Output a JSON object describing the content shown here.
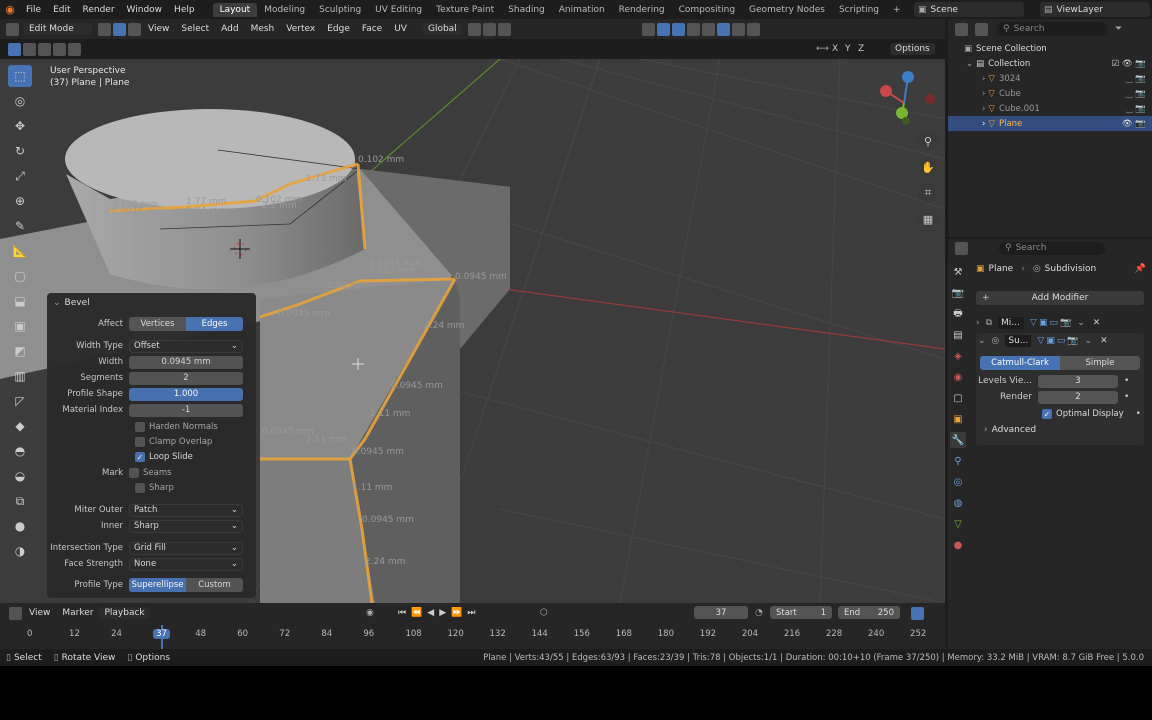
{
  "menus": [
    "File",
    "Edit",
    "Render",
    "Window",
    "Help"
  ],
  "workspaces": [
    "Layout",
    "Modeling",
    "Sculpting",
    "UV Editing",
    "Texture Paint",
    "Shading",
    "Animation",
    "Rendering",
    "Compositing",
    "Geometry Nodes",
    "Scripting"
  ],
  "active_workspace": "Layout",
  "add_workspace": "+",
  "scene": "Scene",
  "view_layer": "ViewLayer",
  "vp_header": {
    "mode": "Edit Mode",
    "menus": [
      "View",
      "Select",
      "Add",
      "Mesh",
      "Vertex",
      "Edge",
      "Face",
      "UV"
    ],
    "orientation": "Global",
    "options": "Options",
    "axes": [
      "X",
      "Y",
      "Z"
    ]
  },
  "viewport": {
    "view_name": "User Perspective",
    "object_info": "(37) Plane | Plane"
  },
  "measurements": [
    {
      "t": "0.102 mm",
      "c": "m1"
    },
    {
      "t": "0.0945 mm",
      "c": "m2"
    },
    {
      "t": "1.77 mm",
      "c": "m3"
    },
    {
      "t": "1.84 mm",
      "c": "m4"
    },
    {
      "t": "0.102 mm",
      "c": "m5"
    },
    {
      "t": "2.2 mm",
      "c": "m6"
    },
    {
      "t": "0.102 mm",
      "c": "m7"
    },
    {
      "t": "1.73 mm",
      "c": "m8"
    },
    {
      "t": "0.0945 mm",
      "c": "m9"
    },
    {
      "t": "0.102 mm",
      "c": "m10"
    },
    {
      "t": "0.0945 mm",
      "c": "m11"
    },
    {
      "t": "1.89 mm",
      "c": "m12"
    },
    {
      "t": "0.0945 mm",
      "c": "m13"
    },
    {
      "t": "2.24 mm",
      "c": "m14"
    },
    {
      "t": "0.0945 mm",
      "c": "m15"
    },
    {
      "t": "1.11 mm",
      "c": "m16"
    },
    {
      "t": "0.0945 mm",
      "c": "m17"
    },
    {
      "t": "1.11 mm",
      "c": "m18"
    },
    {
      "t": "0.0945 mm",
      "c": "m19"
    },
    {
      "t": "1.11 mm",
      "c": "m20"
    },
    {
      "t": "0.0945 mm",
      "c": "m21"
    },
    {
      "t": "2.24 mm",
      "c": "m22"
    }
  ],
  "bevel": {
    "title": "Bevel",
    "affect_label": "Affect",
    "affect_options": [
      "Vertices",
      "Edges"
    ],
    "affect_selected": "Edges",
    "width_type_label": "Width Type",
    "width_type": "Offset",
    "width_label": "Width",
    "width": "0.0945 mm",
    "segments_label": "Segments",
    "segments": "2",
    "profile_shape_label": "Profile Shape",
    "profile_shape": "1.000",
    "material_index_label": "Material Index",
    "material_index": "-1",
    "harden_normals": "Harden Normals",
    "clamp_overlap": "Clamp Overlap",
    "loop_slide": "Loop Slide",
    "mark_label": "Mark",
    "seams": "Seams",
    "sharp": "Sharp",
    "miter_outer_label": "Miter Outer",
    "miter_outer": "Patch",
    "inner_label": "Inner",
    "inner": "Sharp",
    "intersection_type_label": "Intersection Type",
    "intersection_type": "Grid Fill",
    "face_strength_label": "Face Strength",
    "face_strength": "None",
    "profile_type_label": "Profile Type",
    "profile_type_options": [
      "Superellipse",
      "Custom"
    ],
    "profile_type_selected": "Superellipse"
  },
  "timeline": {
    "menus": [
      "Playback"
    ],
    "view": "View",
    "marker": "Marker",
    "current_frame": "37",
    "start_label": "Start",
    "start": "1",
    "end_label": "End",
    "end": "250",
    "ticks": [
      "0",
      "12",
      "24",
      "37",
      "48",
      "60",
      "72",
      "84",
      "96",
      "108",
      "120",
      "132",
      "144",
      "156",
      "168",
      "180",
      "192",
      "204",
      "216",
      "228",
      "240",
      "252"
    ]
  },
  "statusbar": {
    "left": [
      "Select",
      "Rotate View",
      "Options"
    ],
    "right": "Plane | Verts:43/55 | Edges:63/93 | Faces:23/39 | Tris:78 | Objects:1/1 | Duration: 00:10+10 (Frame 37/250) | Memory: 33.2 MiB | VRAM: 8.7 GiB Free | 5.0.0"
  },
  "outliner": {
    "search": "Search",
    "items": [
      {
        "name": "Scene Collection"
      },
      {
        "name": "Collection"
      },
      {
        "name": "3024"
      },
      {
        "name": "Cube"
      },
      {
        "name": "Cube.001"
      },
      {
        "name": "Plane"
      }
    ]
  },
  "properties": {
    "search": "Search",
    "breadcrumb_obj": "Plane",
    "breadcrumb_mod": "Subdivision",
    "add_modifier": "Add Modifier",
    "mod1_name": "Mi...",
    "mod2_name": "Su...",
    "catmull": "Catmull-Clark",
    "simple": "Simple",
    "levels_label": "Levels Vie...",
    "levels": "3",
    "render_label": "Render",
    "render": "2",
    "optimal": "Optimal Display",
    "advanced": "Advanced"
  },
  "colors": {
    "accent": "#4772b3",
    "edge_highlight": "#e8a33a",
    "x_axis": "#c84848",
    "y_axis": "#7ab530",
    "z_axis": "#3d7ec9"
  }
}
